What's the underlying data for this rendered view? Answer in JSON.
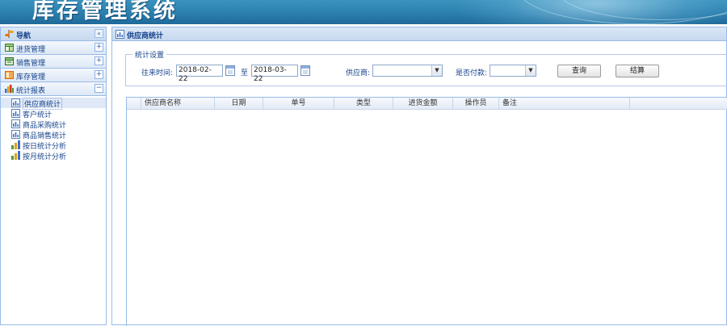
{
  "app": {
    "title": "库存管理系统"
  },
  "sidebar": {
    "header": "导航",
    "collapse_label": "«",
    "sections": [
      {
        "label": "进货管理",
        "toggle": "+"
      },
      {
        "label": "销售管理",
        "toggle": "+"
      },
      {
        "label": "库存管理",
        "toggle": "+"
      },
      {
        "label": "统计报表",
        "toggle": "−"
      }
    ],
    "items": [
      {
        "label": "供应商统计",
        "selected": true
      },
      {
        "label": "客户统计"
      },
      {
        "label": "商品采购统计"
      },
      {
        "label": "商品销售统计"
      },
      {
        "label": "按日统计分析"
      },
      {
        "label": "按月统计分析"
      }
    ]
  },
  "main": {
    "tab_title": "供应商统计",
    "settings": {
      "legend": "统计设置",
      "date_label": "往来时间:",
      "start_date": "2018-02-22",
      "to_label": "至",
      "end_date": "2018-03-22",
      "supplier_label": "供应商:",
      "supplier_value": "",
      "paid_label": "是否付款:",
      "paid_value": "",
      "query_button": "查询",
      "settle_button": "结算"
    },
    "grid": {
      "columns": [
        "供应商名称",
        "日期",
        "单号",
        "类型",
        "进货金额",
        "操作员",
        "备注"
      ],
      "rows": []
    }
  },
  "colors": {
    "header_bg": "#2b7fae",
    "panel_border": "#99bbe8",
    "panel_header": "#dae7f6",
    "text": "#15428b"
  },
  "icons": {
    "nav": "navigation-icon",
    "purchase": "purchase-icon",
    "sales": "sales-icon",
    "inventory": "inventory-icon",
    "report": "chart-icon",
    "calendar": "calendar-icon",
    "dropdown": "chevron-down-icon"
  }
}
